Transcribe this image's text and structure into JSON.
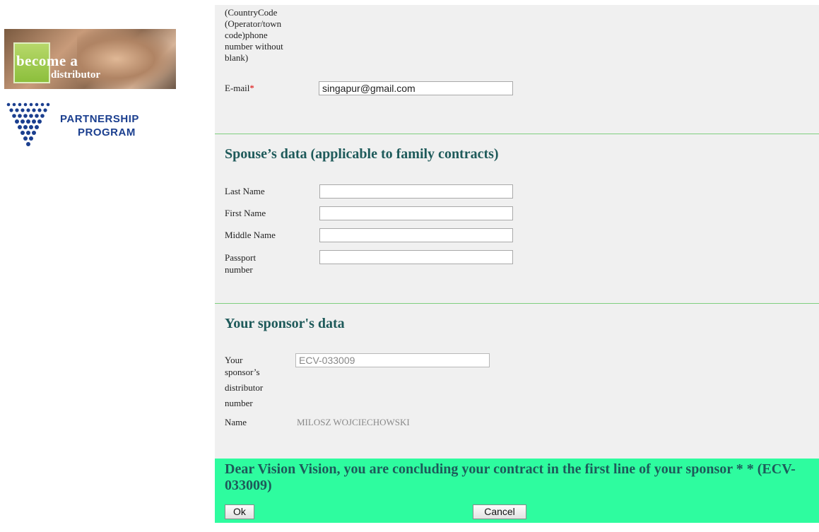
{
  "banner": {
    "line1": "become a",
    "line2": "distributor"
  },
  "partnership": {
    "line1": "PARTNERSHIP",
    "line2": "PROGRAM"
  },
  "contact": {
    "phone_hint": [
      "(CountryCode",
      "(Operator/town",
      "code)phone",
      "number without",
      "blank)"
    ],
    "email_label": "E-mail",
    "required_mark": "*",
    "email_value": "singapur@gmail.com"
  },
  "spouse": {
    "heading": "Spouse’s data (applicable to family contracts)",
    "last_name_label": "Last Name",
    "first_name_label": "First Name",
    "middle_name_label": "Middle Name",
    "passport_label_1": "Passport",
    "passport_label_2": "number",
    "last_name_value": "",
    "first_name_value": "",
    "middle_name_value": "",
    "passport_value": ""
  },
  "sponsor": {
    "heading": "Your sponsor's data",
    "number_label": [
      "Your",
      "sponsor’s",
      "distributor",
      "number"
    ],
    "number_value": "ECV-033009",
    "name_label": "Name",
    "name_value": "MILOSZ WOJCIECHOWSKI"
  },
  "confirm": {
    "message": "Dear Vision Vision, you are concluding your contract in the first line of your sponsor * * (ECV-033009)",
    "ok_label": "Ok",
    "cancel_label": "Cancel"
  }
}
